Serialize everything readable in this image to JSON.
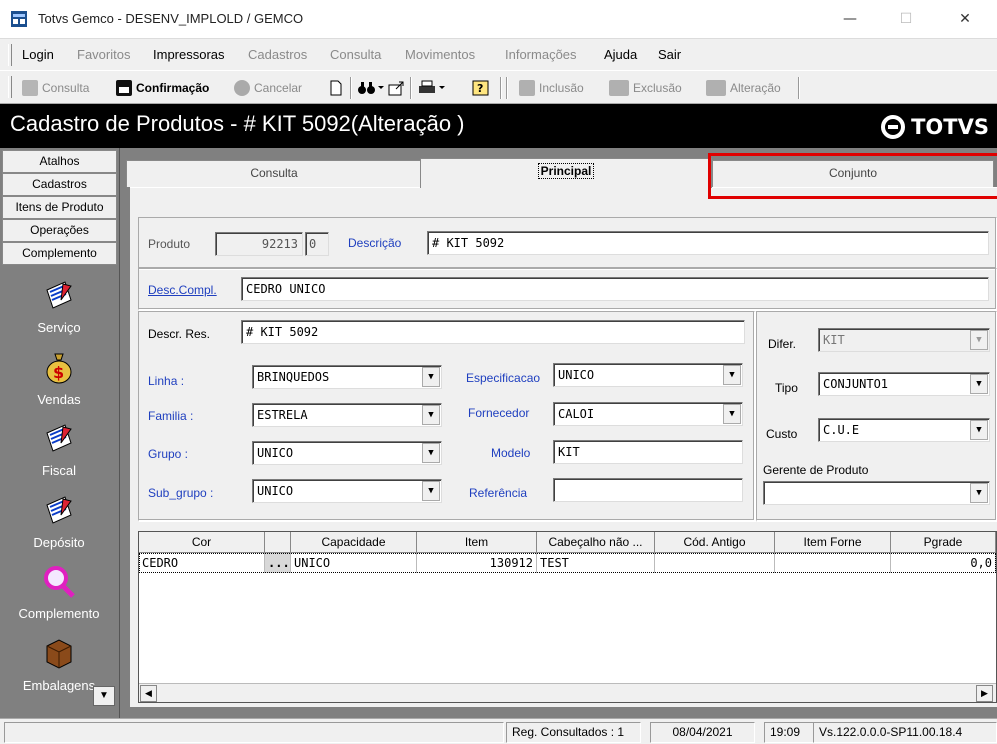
{
  "window": {
    "title": "Totvs Gemco - DESENV_IMPLOLD / GEMCO",
    "minimize": "—",
    "maximize": "☐",
    "close": "✕"
  },
  "menu": {
    "items": [
      {
        "label": "Login",
        "enabled": true
      },
      {
        "label": "Favoritos",
        "enabled": false
      },
      {
        "label": "Impressoras",
        "enabled": true
      },
      {
        "label": "Cadastros",
        "enabled": false
      },
      {
        "label": "Consulta",
        "enabled": false
      },
      {
        "label": "Movimentos",
        "enabled": false
      },
      {
        "label": "Informações",
        "enabled": false
      },
      {
        "label": "Ajuda",
        "enabled": true
      },
      {
        "label": "Sair",
        "enabled": true
      }
    ]
  },
  "toolbar": {
    "consulta": "Consulta",
    "confirmacao": "Confirmação",
    "cancelar": "Cancelar",
    "inclusao": "Inclusão",
    "exclusao": "Exclusão",
    "alteracao": "Alteração"
  },
  "header": {
    "title": "Cadastro de Produtos  - # KIT 5092(Alteração )",
    "logo": "TOTVS"
  },
  "leftnav": {
    "buttons": [
      "Atalhos",
      "Cadastros",
      "Itens de Produto",
      "Operações",
      "Complemento"
    ],
    "icons": [
      {
        "label": "Serviço",
        "icon": "notepad-icon"
      },
      {
        "label": "Vendas",
        "icon": "money-bag-icon"
      },
      {
        "label": "Fiscal",
        "icon": "notepad-icon"
      },
      {
        "label": "Depósito",
        "icon": "notepad-icon"
      },
      {
        "label": "Complemento",
        "icon": "magnifier-icon"
      },
      {
        "label": "Embalagens",
        "icon": "box-icon"
      }
    ],
    "scroll_down": "▼"
  },
  "tabs": {
    "consulta": "Consulta",
    "principal": "Principal",
    "conjunto": "Conjunto"
  },
  "form": {
    "produto_label": "Produto",
    "produto_value": "92213",
    "produto_digit": "0",
    "descricao_label": "Descrição",
    "descricao_value": "# KIT 5092",
    "desc_compl_label": "Desc.Compl.",
    "desc_compl_value": "CEDRO UNICO",
    "descr_res_label": "Descr. Res.",
    "descr_res_value": "# KIT 5092",
    "linha_label": "Linha :",
    "linha_value": "BRINQUEDOS",
    "familia_label": "Familia :",
    "familia_value": "ESTRELA",
    "grupo_label": "Grupo :",
    "grupo_value": "UNICO",
    "subgrupo_label": "Sub_grupo :",
    "subgrupo_value": "UNICO",
    "especificacao_label": "Especificacao",
    "especificacao_value": "UNICO",
    "fornecedor_label": "Fornecedor",
    "fornecedor_value": "CALOI",
    "modelo_label": "Modelo",
    "modelo_value": "KIT",
    "referencia_label": "Referência",
    "referencia_value": "",
    "difer_label": "Difer.",
    "difer_value": "KIT",
    "tipo_label": "Tipo",
    "tipo_value": "CONJUNTO1",
    "custo_label": "Custo",
    "custo_value": "C.U.E",
    "gerente_label": "Gerente de Produto",
    "gerente_value": ""
  },
  "grid": {
    "columns": [
      "Cor",
      "",
      "Capacidade",
      "Item",
      "Cabeçalho não ...",
      "Cód. Antigo",
      "Item Forne",
      "Pgrade"
    ],
    "rows": [
      [
        "CEDRO",
        "...",
        "UNICO",
        "130912",
        "TEST",
        "",
        "",
        "0,0"
      ]
    ]
  },
  "status": {
    "left": "",
    "reg": "Reg. Consultados : 1",
    "date": "08/04/2021",
    "time": "19:09",
    "version": "Vs.122.0.0.0-SP11.00.18.4"
  }
}
